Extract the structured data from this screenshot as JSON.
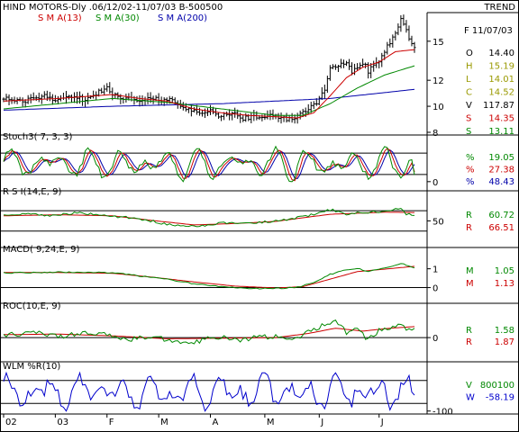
{
  "header": {
    "title": "HIND MOTORS-Dly .06/12/02-11/07/03  B-500500",
    "trend_label": "TREND"
  },
  "colors": {
    "price": "#000000",
    "sma13": "#cc0000",
    "sma30": "#008800",
    "sma200": "#0000aa",
    "stoch_k": "#008800",
    "stoch_d": "#cc0000",
    "stoch_slow": "#0000aa",
    "wlm": "#0000cc",
    "frame": "#000000",
    "grid": "#000000"
  },
  "x_axis": {
    "labels": [
      "02",
      "03",
      "F",
      "M",
      "A",
      "M",
      "J",
      "J"
    ]
  },
  "chart_data": [
    {
      "type": "line",
      "panel": "price",
      "title": "HIND MOTORS-Dly .06/12/02-11/07/03  B-500500",
      "legend": [
        "S M A(13)",
        "S M A(30)",
        "S M A(200)"
      ],
      "y_ticks": [
        8,
        10,
        12,
        15
      ],
      "ylim": [
        8,
        17.2
      ],
      "readout": {
        "date": "F 11/07/03",
        "rows": [
          {
            "k": "O",
            "v": "14.40"
          },
          {
            "k": "H",
            "v": "15.19"
          },
          {
            "k": "L",
            "v": "14.01"
          },
          {
            "k": "C",
            "v": "14.52"
          },
          {
            "k": "V",
            "v": "117.87"
          },
          {
            "k": "S",
            "v": "14.35"
          },
          {
            "k": "S",
            "v": "13.11"
          }
        ]
      },
      "close_anchors": [
        [
          0,
          10.7
        ],
        [
          8,
          10.4
        ],
        [
          14,
          10.8
        ],
        [
          20,
          10.5
        ],
        [
          26,
          10.7
        ],
        [
          30,
          10.5
        ],
        [
          34,
          11.0
        ],
        [
          38,
          11.4
        ],
        [
          42,
          10.6
        ],
        [
          48,
          10.5
        ],
        [
          54,
          10.6
        ],
        [
          60,
          10.5
        ],
        [
          64,
          10.2
        ],
        [
          68,
          9.7
        ],
        [
          72,
          9.4
        ],
        [
          76,
          9.7
        ],
        [
          80,
          9.2
        ],
        [
          84,
          9.5
        ],
        [
          88,
          9.1
        ],
        [
          94,
          9.2
        ],
        [
          98,
          9.4
        ],
        [
          102,
          9.1
        ],
        [
          106,
          9.0
        ],
        [
          110,
          9.6
        ],
        [
          114,
          10.1
        ],
        [
          116,
          10.6
        ],
        [
          118,
          11.4
        ],
        [
          120,
          12.9
        ],
        [
          122,
          13.0
        ],
        [
          124,
          13.3
        ],
        [
          126,
          13.4
        ],
        [
          128,
          12.6
        ],
        [
          130,
          13.0
        ],
        [
          132,
          13.4
        ],
        [
          134,
          12.7
        ],
        [
          136,
          13.3
        ],
        [
          138,
          13.5
        ],
        [
          140,
          14.3
        ],
        [
          142,
          14.8
        ],
        [
          144,
          15.5
        ],
        [
          146,
          16.6
        ],
        [
          148,
          15.8
        ],
        [
          150,
          14.8
        ],
        [
          151,
          14.52
        ]
      ],
      "sma200": [
        [
          0,
          9.7
        ],
        [
          40,
          10.0
        ],
        [
          80,
          10.2
        ],
        [
          120,
          10.6
        ],
        [
          151,
          11.3
        ]
      ],
      "sma30_anchors": [
        [
          0,
          9.8
        ],
        [
          20,
          10.2
        ],
        [
          40,
          10.6
        ],
        [
          60,
          10.3
        ],
        [
          80,
          9.8
        ],
        [
          100,
          9.3
        ],
        [
          110,
          9.3
        ],
        [
          120,
          10.2
        ],
        [
          130,
          11.4
        ],
        [
          140,
          12.4
        ],
        [
          151,
          13.11
        ]
      ],
      "sma13_anchors": [
        [
          0,
          10.4
        ],
        [
          20,
          10.6
        ],
        [
          40,
          10.9
        ],
        [
          50,
          10.6
        ],
        [
          60,
          10.4
        ],
        [
          70,
          9.8
        ],
        [
          80,
          9.5
        ],
        [
          90,
          9.3
        ],
        [
          100,
          9.2
        ],
        [
          108,
          9.1
        ],
        [
          114,
          9.5
        ],
        [
          120,
          10.8
        ],
        [
          126,
          12.2
        ],
        [
          132,
          13.0
        ],
        [
          138,
          13.4
        ],
        [
          144,
          14.2
        ],
        [
          151,
          14.35
        ]
      ]
    },
    {
      "type": "line",
      "panel": "stoch",
      "title": "Stoch3( 7, 3, 3)",
      "y_ticks": [
        0
      ],
      "ylim": [
        -8,
        108
      ],
      "levels": [
        20,
        80
      ],
      "readout": {
        "rows": [
          {
            "k": "%",
            "v": "19.05"
          },
          {
            "k": "%",
            "v": "27.38"
          },
          {
            "k": "%",
            "v": "48.43"
          }
        ]
      },
      "final": [
        19.05,
        27.38,
        48.43
      ]
    },
    {
      "type": "line",
      "panel": "rsi",
      "title": "R S I(14,E, 9)",
      "y_ticks": [
        50
      ],
      "ylim": [
        10,
        95
      ],
      "levels": [
        70,
        30
      ],
      "readout": {
        "rows": [
          {
            "k": "R",
            "v": "60.72"
          },
          {
            "k": "R",
            "v": "66.51"
          }
        ]
      },
      "rsi_anchors": [
        [
          0,
          62
        ],
        [
          10,
          64
        ],
        [
          18,
          60
        ],
        [
          26,
          66
        ],
        [
          34,
          62
        ],
        [
          42,
          58
        ],
        [
          50,
          54
        ],
        [
          56,
          48
        ],
        [
          62,
          42
        ],
        [
          68,
          38
        ],
        [
          72,
          40
        ],
        [
          80,
          46
        ],
        [
          88,
          44
        ],
        [
          96,
          48
        ],
        [
          104,
          52
        ],
        [
          110,
          58
        ],
        [
          116,
          66
        ],
        [
          120,
          72
        ],
        [
          126,
          64
        ],
        [
          134,
          66
        ],
        [
          140,
          70
        ],
        [
          146,
          74
        ],
        [
          148,
          64
        ],
        [
          151,
          60.72
        ]
      ],
      "signal_anchors": [
        [
          0,
          60
        ],
        [
          20,
          62
        ],
        [
          40,
          60
        ],
        [
          56,
          50
        ],
        [
          70,
          42
        ],
        [
          86,
          45
        ],
        [
          100,
          49
        ],
        [
          110,
          56
        ],
        [
          120,
          63
        ],
        [
          130,
          65
        ],
        [
          140,
          67
        ],
        [
          151,
          66.51
        ]
      ]
    },
    {
      "type": "line",
      "panel": "macd",
      "title": "MACD( 9,24,E, 9)",
      "y_ticks": [
        1,
        0
      ],
      "ylim": [
        -0.5,
        1.7
      ],
      "readout": {
        "rows": [
          {
            "k": "M",
            "v": "1.05"
          },
          {
            "k": "M",
            "v": "1.13"
          }
        ]
      },
      "macd_anchors": [
        [
          0,
          0.78
        ],
        [
          20,
          0.82
        ],
        [
          40,
          0.8
        ],
        [
          50,
          0.62
        ],
        [
          60,
          0.45
        ],
        [
          70,
          0.2
        ],
        [
          80,
          0.05
        ],
        [
          90,
          -0.05
        ],
        [
          100,
          -0.05
        ],
        [
          108,
          0.02
        ],
        [
          114,
          0.25
        ],
        [
          120,
          0.7
        ],
        [
          126,
          0.95
        ],
        [
          130,
          1.0
        ],
        [
          134,
          0.88
        ],
        [
          140,
          1.02
        ],
        [
          146,
          1.3
        ],
        [
          151,
          1.05
        ]
      ],
      "signal_anchors": [
        [
          0,
          0.8
        ],
        [
          20,
          0.8
        ],
        [
          40,
          0.76
        ],
        [
          55,
          0.55
        ],
        [
          70,
          0.3
        ],
        [
          85,
          0.08
        ],
        [
          100,
          -0.02
        ],
        [
          110,
          0.05
        ],
        [
          120,
          0.45
        ],
        [
          130,
          0.85
        ],
        [
          140,
          0.98
        ],
        [
          151,
          1.13
        ]
      ]
    },
    {
      "type": "line",
      "panel": "roc",
      "title": "ROC(10,E, 9)",
      "y_ticks": [
        0
      ],
      "ylim": [
        -3.5,
        4.3
      ],
      "readout": {
        "rows": [
          {
            "k": "R",
            "v": "1.58"
          },
          {
            "k": "R",
            "v": "1.87"
          }
        ]
      },
      "roc_anchors": [
        [
          0,
          0.4
        ],
        [
          10,
          0.9
        ],
        [
          20,
          0.1
        ],
        [
          30,
          1.0
        ],
        [
          38,
          0.6
        ],
        [
          46,
          -0.3
        ],
        [
          54,
          0.2
        ],
        [
          62,
          -0.6
        ],
        [
          70,
          -0.8
        ],
        [
          78,
          0.2
        ],
        [
          86,
          -0.5
        ],
        [
          94,
          0.1
        ],
        [
          100,
          0.3
        ],
        [
          106,
          -0.4
        ],
        [
          112,
          1.1
        ],
        [
          118,
          2.3
        ],
        [
          122,
          3.0
        ],
        [
          126,
          0.8
        ],
        [
          130,
          1.6
        ],
        [
          134,
          -0.5
        ],
        [
          138,
          1.3
        ],
        [
          142,
          1.6
        ],
        [
          146,
          2.4
        ],
        [
          148,
          1.2
        ],
        [
          151,
          1.58
        ]
      ],
      "signal_anchors": [
        [
          0,
          0.5
        ],
        [
          20,
          0.6
        ],
        [
          40,
          0.3
        ],
        [
          60,
          -0.2
        ],
        [
          80,
          -0.1
        ],
        [
          100,
          0.0
        ],
        [
          112,
          0.7
        ],
        [
          122,
          1.6
        ],
        [
          132,
          1.1
        ],
        [
          142,
          1.6
        ],
        [
          151,
          1.87
        ]
      ]
    },
    {
      "type": "line",
      "panel": "wlm",
      "title": "WLM %R(10)",
      "y_ticks": [
        -100
      ],
      "ylim": [
        -103,
        3
      ],
      "levels": [
        -20,
        -80
      ],
      "readout": {
        "rows": [
          {
            "k": "V",
            "v": "800100"
          },
          {
            "k": "W",
            "v": "-58.19"
          }
        ]
      },
      "final": -58.19
    }
  ]
}
